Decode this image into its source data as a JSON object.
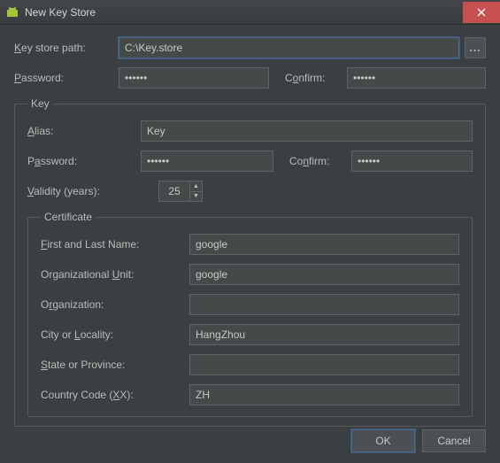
{
  "window": {
    "title": "New Key Store"
  },
  "keystore": {
    "path_label": "Key store path:",
    "path_value": "C:\\Key.store",
    "password_label": "Password:",
    "password_value": "••••••",
    "confirm_label": "Confirm:",
    "confirm_value": "••••••"
  },
  "key_section": {
    "legend": "Key",
    "alias_label": "Alias:",
    "alias_value": "Key",
    "password_label": "Password:",
    "password_value": "••••••",
    "confirm_label": "Confirm:",
    "confirm_value": "••••••",
    "validity_label": "Validity (years):",
    "validity_value": "25"
  },
  "certificate": {
    "legend": "Certificate",
    "first_last_label": "First and Last Name:",
    "first_last_value": "google",
    "ou_label": "Organizational Unit:",
    "ou_value": "google",
    "org_label": "Organization:",
    "org_value": "",
    "city_label": "City or Locality:",
    "city_value": "HangZhou",
    "state_label": "State or Province:",
    "state_value": "",
    "country_label": "Country Code (XX):",
    "country_value": "ZH"
  },
  "buttons": {
    "ok": "OK",
    "cancel": "Cancel"
  }
}
